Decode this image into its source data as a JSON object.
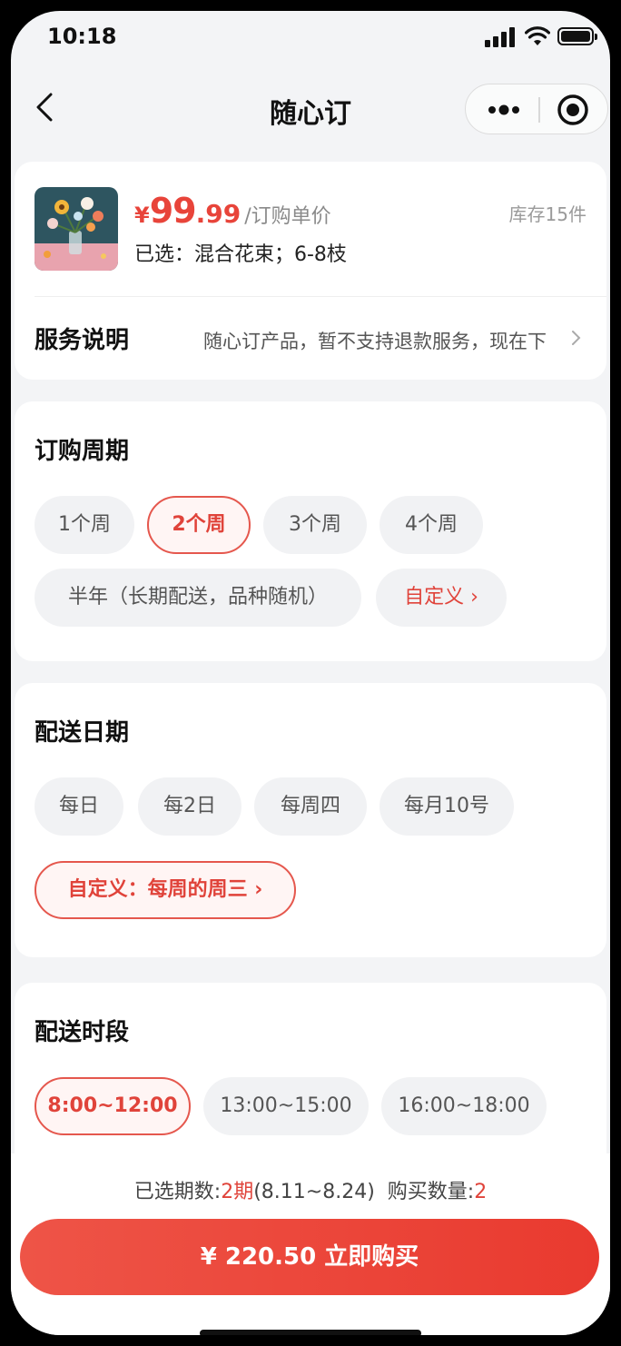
{
  "status": {
    "time": "10:18"
  },
  "nav": {
    "title": "随心订"
  },
  "product": {
    "currency": "¥",
    "price_int": "99",
    "price_dec": ".99",
    "unit_label": "/订购单价",
    "stock": "库存15件",
    "selected": "已选：混合花束；6-8枝"
  },
  "service": {
    "label": "服务说明",
    "text": "随心订产品，暂不支持退款服务，现在下"
  },
  "cycle": {
    "title": "订购周期",
    "options": [
      "1个周",
      "2个周",
      "3个周",
      "4个周",
      "半年（长期配送，品种随机）",
      "自定义 ›"
    ],
    "selected": "2个周"
  },
  "delivery_date": {
    "title": "配送日期",
    "options": [
      "每日",
      "每2日",
      "每周四",
      "每月10号",
      "自定义：每周的周三 ›"
    ],
    "selected": "自定义：每周的周三 ›"
  },
  "time_slot": {
    "title": "配送时段",
    "options": [
      "8:00~12:00",
      "13:00~15:00",
      "16:00~18:00"
    ],
    "selected": "8:00~12:00"
  },
  "summary": {
    "periods_label": "已选期数:",
    "periods_value": "2期",
    "periods_range": "(8.11~8.24)",
    "qty_label": "购买数量:",
    "qty_value": "2"
  },
  "buy_button": {
    "label": "¥ 220.50 立即购买"
  },
  "colors": {
    "accent": "#e8443a",
    "chip_bg": "#f1f2f4",
    "page_bg": "#f3f4f6"
  }
}
